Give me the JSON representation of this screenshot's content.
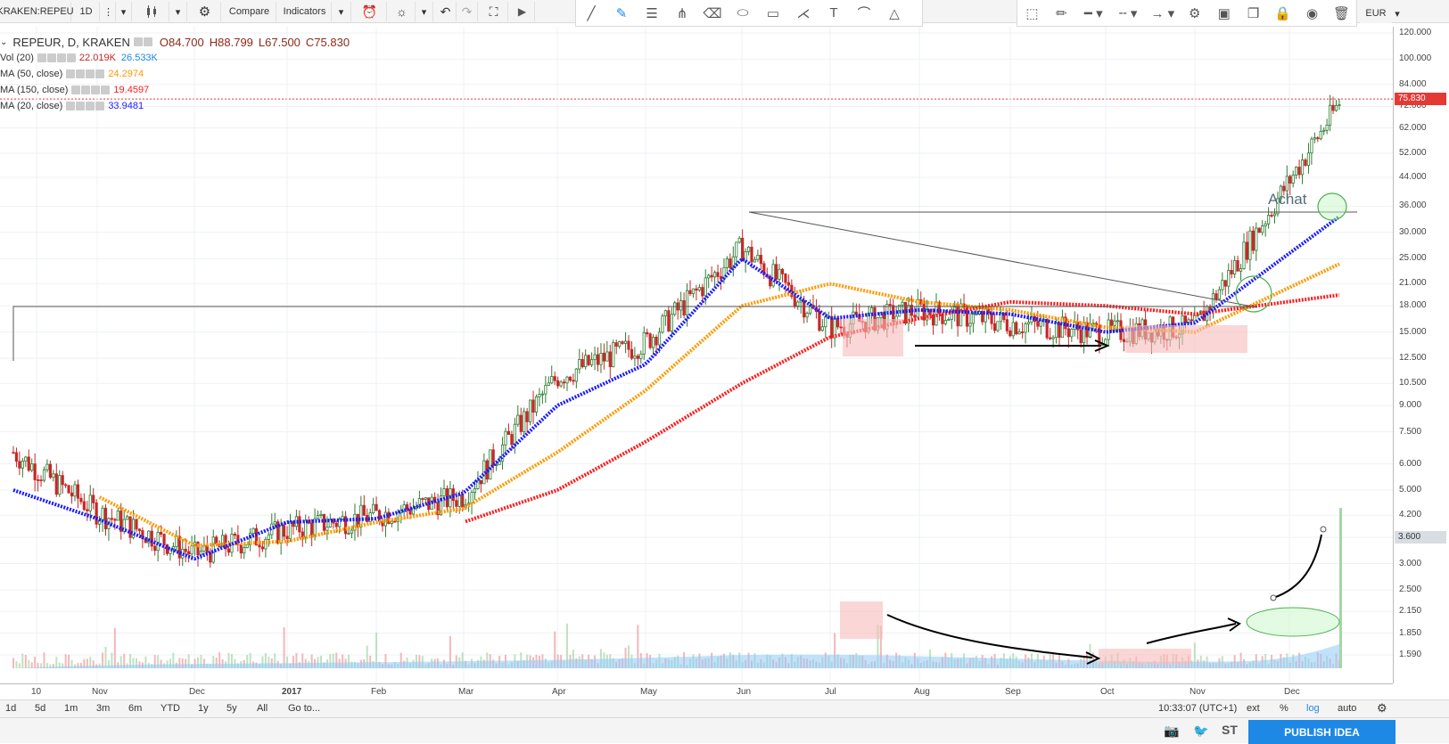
{
  "toolbar": {
    "symbol": "KRAKEN:REPEU",
    "interval": "1D",
    "compare": "Compare",
    "indicators": "Indicators"
  },
  "legend": {
    "title": "REPEUR, D, KRAKEN",
    "ohlc": {
      "o": "O84.700",
      "h": "H88.799",
      "l": "L67.500",
      "c": "C75.830"
    },
    "vol": {
      "label": "Vol (20)",
      "v1": "22.019K",
      "v2": "26.533K"
    },
    "ma50": {
      "label": "MA (50, close)",
      "value": "24.2974"
    },
    "ma150": {
      "label": "MA (150, close)",
      "value": "19.4597"
    },
    "ma20": {
      "label": "MA (20, close)",
      "value": "33.9481"
    }
  },
  "price_axis": {
    "ticks": [
      "120.000",
      "100.000",
      "84.000",
      "72.000",
      "62.000",
      "52.000",
      "44.000",
      "36.000",
      "30.000",
      "25.000",
      "21.000",
      "18.000",
      "15.000",
      "12.500",
      "10.500",
      "9.000",
      "7.500",
      "6.000",
      "5.000",
      "4.200",
      "3.600",
      "3.000",
      "2.500",
      "2.150",
      "1.850",
      "1.590"
    ],
    "current": "75.830",
    "volume_marker": "3.600",
    "currency": "EUR"
  },
  "time_axis": {
    "ticks": [
      "10",
      "Nov",
      "Dec",
      "2017",
      "Feb",
      "Mar",
      "Apr",
      "May",
      "Jun",
      "Jul",
      "Aug",
      "Sep",
      "Oct",
      "Nov",
      "Dec"
    ]
  },
  "annotation": {
    "achat": "Achat"
  },
  "bottom_bar": {
    "ranges": [
      "1d",
      "5d",
      "1m",
      "3m",
      "6m",
      "YTD",
      "1y",
      "5y",
      "All"
    ],
    "goto": "Go to...",
    "time": "10:33:07 (UTC+1)",
    "ext": "ext",
    "percent": "%",
    "log": "log",
    "auto": "auto"
  },
  "footer": {
    "publish": "PUBLISH IDEA",
    "st": "ST"
  },
  "colors": {
    "ma20": "#1a1aff",
    "ma50": "#ff9900",
    "ma150": "#ff1a1a",
    "up": "#2e7d32",
    "down": "#c62828",
    "price_label_bg": "#e53935",
    "publish_bg": "#1e88e5"
  },
  "chart_data": {
    "type": "line",
    "title": "REPEUR, D, KRAKEN",
    "scale": "log",
    "ylim": [
      1.59,
      120
    ],
    "categories": [
      "10",
      "Nov",
      "Dec",
      "2017",
      "Feb",
      "Mar",
      "Apr",
      "May",
      "Jun",
      "Jul",
      "Aug",
      "Sep",
      "Oct",
      "Nov",
      "Dec"
    ],
    "series": [
      {
        "name": "Price",
        "values": [
          6.5,
          4.3,
          3.2,
          3.8,
          4.2,
          4.8,
          11.0,
          14.0,
          27.0,
          15.5,
          17.5,
          16.0,
          15.0,
          15.5,
          75.83
        ]
      },
      {
        "name": "MA (20, close)",
        "values": [
          5.0,
          4.1,
          3.1,
          4.0,
          4.1,
          4.9,
          9.0,
          12.0,
          25.0,
          16.5,
          17.5,
          17.0,
          15.0,
          16.0,
          33.9481
        ]
      },
      {
        "name": "MA (50, close)",
        "values": [
          null,
          4.8,
          3.4,
          3.5,
          4.0,
          4.4,
          6.5,
          10.0,
          18.0,
          21.0,
          18.5,
          17.5,
          15.5,
          15.0,
          24.2974
        ]
      },
      {
        "name": "MA (150, close)",
        "values": [
          null,
          null,
          null,
          null,
          null,
          4.0,
          5.0,
          7.0,
          10.5,
          14.5,
          16.5,
          18.5,
          18.0,
          17.0,
          19.4597
        ]
      }
    ]
  }
}
